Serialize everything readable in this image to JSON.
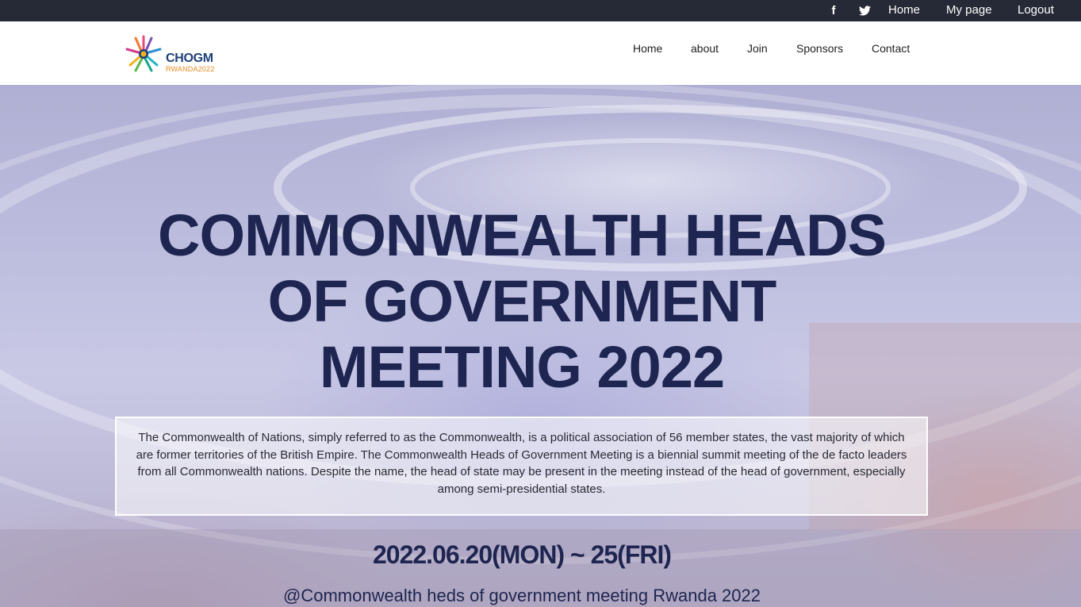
{
  "topbar": {
    "links": {
      "home": "Home",
      "mypage": "My page",
      "logout": "Logout"
    },
    "icons": [
      "facebook-icon",
      "twitter-icon"
    ],
    "background": "#262a36"
  },
  "logo": {
    "name": "CHOGM",
    "subtitle": "RWANDA2022"
  },
  "nav": {
    "home": "Home",
    "about": "about",
    "join": "Join",
    "sponsors": "Sponsors",
    "contact": "Contact"
  },
  "hero": {
    "title_line1": "COMMONWEALTH HEADS",
    "title_line2": "OF GOVERNMENT",
    "title_line3": "MEETING 2022",
    "description": "The Commonwealth of Nations, simply referred to as the Commonwealth, is a political association of 56 member states, the vast majority of which are former territories of the British Empire. The Commonwealth Heads of Government Meeting is a biennial summit meeting of the de facto leaders from all Commonwealth nations. Despite the name, the head of state may be present in the meeting instead of the head of government, especially among semi-presidential states.",
    "date": "2022.06.20(MON) ~ 25(FRI)",
    "venue": "@Commonwealth heds of government meeting Rwanda 2022"
  },
  "colors": {
    "headline": "#1e2550",
    "logo_text": "#1d3f78",
    "logo_sub": "#e58a1f"
  }
}
